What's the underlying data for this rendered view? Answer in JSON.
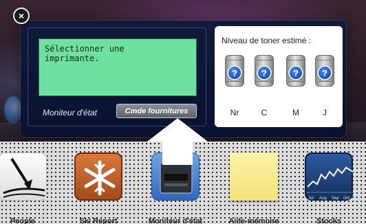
{
  "printer_widget": {
    "status_message": "Sélectionner une\nimprimante.",
    "status_label": "Moniteur d'état",
    "supplies_button_label": "Cmde fournitures",
    "toner": {
      "title": "Niveau de toner estimé :",
      "cartridges": [
        {
          "label": "Nr",
          "level_symbol": "?"
        },
        {
          "label": "C",
          "level_symbol": "?"
        },
        {
          "label": "M",
          "level_symbol": "?"
        },
        {
          "label": "J",
          "level_symbol": "?"
        }
      ]
    },
    "close_symbol": "×"
  },
  "dock": {
    "items": [
      {
        "label": "People",
        "icon": "people-icon"
      },
      {
        "label": "Ski Report",
        "icon": "snowflake-icon"
      },
      {
        "label": "Moniteur d'état",
        "icon": "printer-icon"
      },
      {
        "label": "Aide-mémoire",
        "icon": "sticky-note-icon"
      },
      {
        "label": "Stocks",
        "icon": "stocks-chart-icon"
      }
    ],
    "stocks_axis_labels": [
      "Jul",
      "Aug",
      "Sep",
      "Oct"
    ]
  },
  "colors": {
    "lcd_green": "#6ee0a0",
    "widget_navy": "#0f1a3a",
    "ski_orange": "#c0602a",
    "note_yellow": "#f8ef9a",
    "stocks_blue": "#1d3f78"
  }
}
